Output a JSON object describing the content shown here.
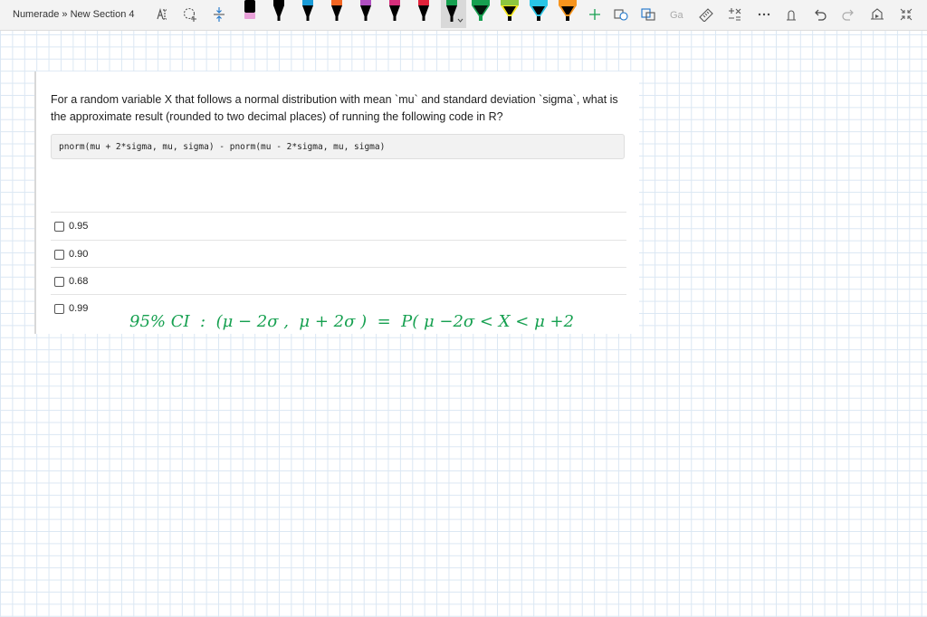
{
  "toolbar": {
    "breadcrumb": {
      "notebook": "Numerade",
      "separator": "»",
      "section": "New Section 4"
    },
    "pen_colors": [
      "#000000",
      "#e8a0d8",
      "#000000",
      "#1a9bd7",
      "#f26522",
      "#b04fc0",
      "#d62f7c",
      "#e2213a",
      "#16a050",
      "#8dc63f",
      "#f6e71d",
      "#29c5e6",
      "#f7941d"
    ],
    "selected_pen_color": "#16a050",
    "icons": [
      "lasso-select-icon",
      "add-space-icon",
      "add-space-vertical-icon",
      "add-icon",
      "shapes-icon",
      "ink-to-shape-icon",
      "ink-to-text-icon",
      "ruler-icon",
      "math-icon",
      "more-icon",
      "touch-draw-icon",
      "undo-icon",
      "redo-icon",
      "replay-icon",
      "collapse-icon"
    ]
  },
  "question": {
    "text": "For a random variable X that follows a normal distribution with mean `mu` and standard deviation `sigma`, what is the approximate result (rounded to two decimal places) of running the following code in R?",
    "code": "pnorm(mu + 2*sigma, mu, sigma) - pnorm(mu - 2*sigma, mu, sigma)",
    "options": [
      "0.95",
      "0.90",
      "0.68",
      "0.99"
    ]
  },
  "handwriting": {
    "color": "#16a050",
    "text": "95% CI  :  (μ − 2σ ,  μ + 2σ )  =  P( μ −2σ < X < μ +2"
  }
}
